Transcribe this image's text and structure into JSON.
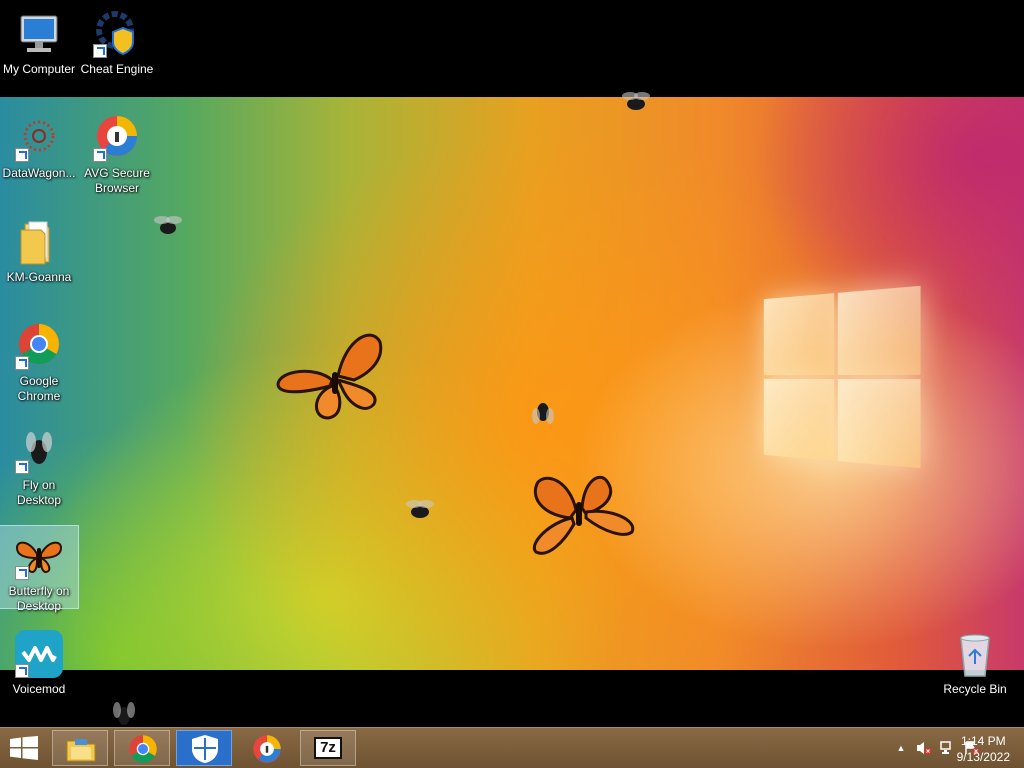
{
  "desktop": {
    "icons": [
      {
        "label": "My Computer"
      },
      {
        "label": "Cheat Engine"
      },
      {
        "label": "DataWagon..."
      },
      {
        "label": "AVG Secure Browser"
      },
      {
        "label": "KM-Goanna"
      },
      {
        "label": "Google Chrome"
      },
      {
        "label": "Fly on Desktop"
      },
      {
        "label": "Butterfly on Desktop"
      },
      {
        "label": "Voicemod"
      },
      {
        "label": "Recycle Bin"
      }
    ]
  },
  "taskbar": {
    "pinned": [
      "file-explorer-icon",
      "chrome-icon",
      "defender-icon",
      "avg-browser-icon",
      "7zip-icon"
    ],
    "seven_zip_text": "7z",
    "clock": {
      "time": "1:14 PM",
      "date": "9/13/2022"
    }
  },
  "colors": {
    "taskbar": "#6e5232",
    "accent": "#1e6fd9"
  }
}
